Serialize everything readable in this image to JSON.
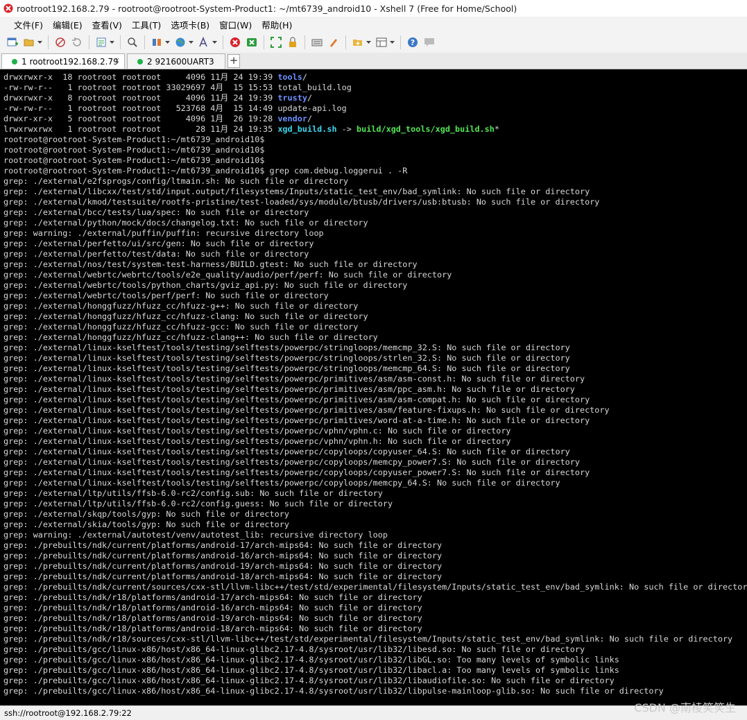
{
  "window": {
    "title": "rootroot192.168.2.79 - rootroot@rootroot-System-Product1: ~/mt6739_android10 - Xshell 7 (Free for Home/School)"
  },
  "menu": [
    "文件(F)",
    "编辑(E)",
    "查看(V)",
    "工具(T)",
    "选项卡(B)",
    "窗口(W)",
    "帮助(H)"
  ],
  "toolbar_icons": [
    "new-session-icon",
    "open-folder-icon",
    "disconnect-icon",
    "reconnect-icon",
    "properties-icon",
    "find-icon",
    "transfer-icon",
    "globe-icon",
    "font-icon",
    "xshell-logo-icon",
    "xftp-icon",
    "fullscreen-icon",
    "lock-icon",
    "keyboard-icon",
    "highlight-icon",
    "new-tab-icon",
    "layout-icon",
    "help-icon",
    "chat-icon"
  ],
  "tabs": [
    {
      "label": "1 rootroot192.168.2.79",
      "active": true,
      "dot_color": "#1fb24a"
    },
    {
      "label": "2 921600UART3",
      "active": false,
      "dot_color": "#1fb24a"
    }
  ],
  "terminal": {
    "lines": [
      [
        {
          "t": "drwxrwxr-x  18 rootroot rootroot     4096 11月 24 19:39 "
        },
        {
          "t": "tools",
          "c": "dir"
        },
        {
          "t": "/"
        }
      ],
      [
        {
          "t": "-rw-rw-r--   1 rootroot rootroot 33029697 4月  15 15:53 total_build.log"
        }
      ],
      [
        {
          "t": "drwxrwxr-x   8 rootroot rootroot     4096 11月 24 19:39 "
        },
        {
          "t": "trusty",
          "c": "dir"
        },
        {
          "t": "/"
        }
      ],
      [
        {
          "t": "-rw-rw-r--   1 rootroot rootroot   523768 4月  15 14:49 update-api.log"
        }
      ],
      [
        {
          "t": "drwxr-xr-x   5 rootroot rootroot     4096 1月  26 19:28 "
        },
        {
          "t": "vendor",
          "c": "dir"
        },
        {
          "t": "/"
        }
      ],
      [
        {
          "t": "lrwxrwxrwx   1 rootroot rootroot       28 11月 24 19:35 "
        },
        {
          "t": "xgd_build.sh",
          "c": "link"
        },
        {
          "t": " -> "
        },
        {
          "t": "build/xgd_tools/xgd_build.sh",
          "c": "exe"
        },
        {
          "t": "*"
        }
      ],
      [
        {
          "t": "rootroot@rootroot-System-Product1:~/mt6739_android10$"
        }
      ],
      [
        {
          "t": "rootroot@rootroot-System-Product1:~/mt6739_android10$"
        }
      ],
      [
        {
          "t": "rootroot@rootroot-System-Product1:~/mt6739_android10$"
        }
      ],
      [
        {
          "t": "rootroot@rootroot-System-Product1:~/mt6739_android10$ grep com.debug.loggerui . -R"
        }
      ],
      [
        {
          "t": "grep: ./external/e2fsprogs/config/ltmain.sh: No such file or directory"
        }
      ],
      [
        {
          "t": "grep: ./external/libcxx/test/std/input.output/filesystems/Inputs/static_test_env/bad_symlink: No such file or directory"
        }
      ],
      [
        {
          "t": "grep: ./external/kmod/testsuite/rootfs-pristine/test-loaded/sys/module/btusb/drivers/usb:btusb: No such file or directory"
        }
      ],
      [
        {
          "t": "grep: ./external/bcc/tests/lua/spec: No such file or directory"
        }
      ],
      [
        {
          "t": "grep: ./external/python/mock/docs/changelog.txt: No such file or directory"
        }
      ],
      [
        {
          "t": "grep: warning: ./external/puffin/puffin: recursive directory loop"
        }
      ],
      [
        {
          "t": "grep: ./external/perfetto/ui/src/gen: No such file or directory"
        }
      ],
      [
        {
          "t": "grep: ./external/perfetto/test/data: No such file or directory"
        }
      ],
      [
        {
          "t": "grep: ./external/nos/test/system-test-harness/BUILD.gtest: No such file or directory"
        }
      ],
      [
        {
          "t": "grep: ./external/webrtc/webrtc/tools/e2e_quality/audio/perf/perf: No such file or directory"
        }
      ],
      [
        {
          "t": "grep: ./external/webrtc/tools/python_charts/gviz_api.py: No such file or directory"
        }
      ],
      [
        {
          "t": "grep: ./external/webrtc/tools/perf/perf: No such file or directory"
        }
      ],
      [
        {
          "t": "grep: ./external/honggfuzz/hfuzz_cc/hfuzz-g++: No such file or directory"
        }
      ],
      [
        {
          "t": "grep: ./external/honggfuzz/hfuzz_cc/hfuzz-clang: No such file or directory"
        }
      ],
      [
        {
          "t": "grep: ./external/honggfuzz/hfuzz_cc/hfuzz-gcc: No such file or directory"
        }
      ],
      [
        {
          "t": "grep: ./external/honggfuzz/hfuzz_cc/hfuzz-clang++: No such file or directory"
        }
      ],
      [
        {
          "t": "grep: ./external/linux-kselftest/tools/testing/selftests/powerpc/stringloops/memcmp_32.S: No such file or directory"
        }
      ],
      [
        {
          "t": "grep: ./external/linux-kselftest/tools/testing/selftests/powerpc/stringloops/strlen_32.S: No such file or directory"
        }
      ],
      [
        {
          "t": "grep: ./external/linux-kselftest/tools/testing/selftests/powerpc/stringloops/memcmp_64.S: No such file or directory"
        }
      ],
      [
        {
          "t": "grep: ./external/linux-kselftest/tools/testing/selftests/powerpc/primitives/asm/asm-const.h: No such file or directory"
        }
      ],
      [
        {
          "t": "grep: ./external/linux-kselftest/tools/testing/selftests/powerpc/primitives/asm/ppc_asm.h: No such file or directory"
        }
      ],
      [
        {
          "t": "grep: ./external/linux-kselftest/tools/testing/selftests/powerpc/primitives/asm/asm-compat.h: No such file or directory"
        }
      ],
      [
        {
          "t": "grep: ./external/linux-kselftest/tools/testing/selftests/powerpc/primitives/asm/feature-fixups.h: No such file or directory"
        }
      ],
      [
        {
          "t": "grep: ./external/linux-kselftest/tools/testing/selftests/powerpc/primitives/word-at-a-time.h: No such file or directory"
        }
      ],
      [
        {
          "t": "grep: ./external/linux-kselftest/tools/testing/selftests/powerpc/vphn/vphn.c: No such file or directory"
        }
      ],
      [
        {
          "t": "grep: ./external/linux-kselftest/tools/testing/selftests/powerpc/vphn/vphn.h: No such file or directory"
        }
      ],
      [
        {
          "t": "grep: ./external/linux-kselftest/tools/testing/selftests/powerpc/copyloops/copyuser_64.S: No such file or directory"
        }
      ],
      [
        {
          "t": "grep: ./external/linux-kselftest/tools/testing/selftests/powerpc/copyloops/memcpy_power7.S: No such file or directory"
        }
      ],
      [
        {
          "t": "grep: ./external/linux-kselftest/tools/testing/selftests/powerpc/copyloops/copyuser_power7.S: No such file or directory"
        }
      ],
      [
        {
          "t": "grep: ./external/linux-kselftest/tools/testing/selftests/powerpc/copyloops/memcpy_64.S: No such file or directory"
        }
      ],
      [
        {
          "t": "grep: ./external/ltp/utils/ffsb-6.0-rc2/config.sub: No such file or directory"
        }
      ],
      [
        {
          "t": "grep: ./external/ltp/utils/ffsb-6.0-rc2/config.guess: No such file or directory"
        }
      ],
      [
        {
          "t": "grep: ./external/skqp/tools/gyp: No such file or directory"
        }
      ],
      [
        {
          "t": "grep: ./external/skia/tools/gyp: No such file or directory"
        }
      ],
      [
        {
          "t": "grep: warning: ./external/autotest/venv/autotest_lib: recursive directory loop"
        }
      ],
      [
        {
          "t": "grep: ./prebuilts/ndk/current/platforms/android-17/arch-mips64: No such file or directory"
        }
      ],
      [
        {
          "t": "grep: ./prebuilts/ndk/current/platforms/android-16/arch-mips64: No such file or directory"
        }
      ],
      [
        {
          "t": "grep: ./prebuilts/ndk/current/platforms/android-19/arch-mips64: No such file or directory"
        }
      ],
      [
        {
          "t": "grep: ./prebuilts/ndk/current/platforms/android-18/arch-mips64: No such file or directory"
        }
      ],
      [
        {
          "t": "grep: ./prebuilts/ndk/current/sources/cxx-stl/llvm-libc++/test/std/experimental/filesystem/Inputs/static_test_env/bad_symlink: No such file or directory"
        }
      ],
      [
        {
          "t": "grep: ./prebuilts/ndk/r18/platforms/android-17/arch-mips64: No such file or directory"
        }
      ],
      [
        {
          "t": "grep: ./prebuilts/ndk/r18/platforms/android-16/arch-mips64: No such file or directory"
        }
      ],
      [
        {
          "t": "grep: ./prebuilts/ndk/r18/platforms/android-19/arch-mips64: No such file or directory"
        }
      ],
      [
        {
          "t": "grep: ./prebuilts/ndk/r18/platforms/android-18/arch-mips64: No such file or directory"
        }
      ],
      [
        {
          "t": "grep: ./prebuilts/ndk/r18/sources/cxx-stl/llvm-libc++/test/std/experimental/filesystem/Inputs/static_test_env/bad_symlink: No such file or directory"
        }
      ],
      [
        {
          "t": "grep: ./prebuilts/gcc/linux-x86/host/x86_64-linux-glibc2.17-4.8/sysroot/usr/lib32/libesd.so: No such file or directory"
        }
      ],
      [
        {
          "t": "grep: ./prebuilts/gcc/linux-x86/host/x86_64-linux-glibc2.17-4.8/sysroot/usr/lib32/libGL.so: Too many levels of symbolic links"
        }
      ],
      [
        {
          "t": "grep: ./prebuilts/gcc/linux-x86/host/x86_64-linux-glibc2.17-4.8/sysroot/usr/lib32/libacl.a: Too many levels of symbolic links"
        }
      ],
      [
        {
          "t": "grep: ./prebuilts/gcc/linux-x86/host/x86_64-linux-glibc2.17-4.8/sysroot/usr/lib32/libaudiofile.so: No such file or directory"
        }
      ],
      [
        {
          "t": "grep: ./prebuilts/gcc/linux-x86/host/x86_64-linux-glibc2.17-4.8/sysroot/usr/lib32/libpulse-mainloop-glib.so: No such file or directory"
        }
      ]
    ]
  },
  "status": {
    "connection": "ssh://rootroot@192.168.2.79:22"
  },
  "watermark": "CSDN @南棱笑笑生",
  "colors": {
    "terminal_bg": "#000000",
    "terminal_fg": "#d8d8d8",
    "dir": "#6b8fff",
    "link": "#3cd7ef",
    "exe": "#51e651",
    "tab_dot": "#1fb24a"
  }
}
